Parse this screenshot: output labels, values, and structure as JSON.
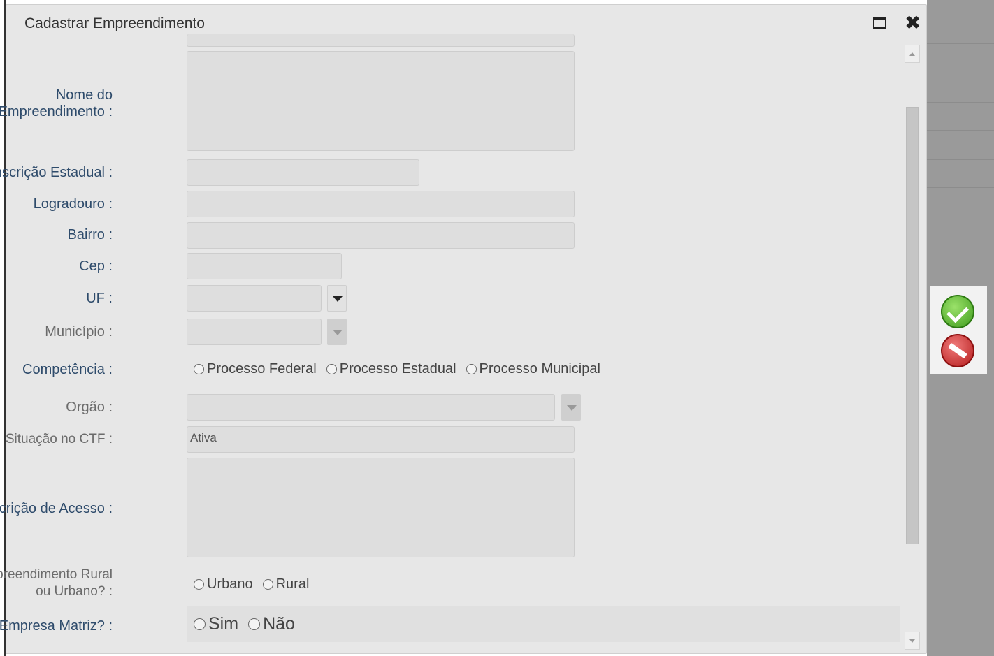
{
  "dialog": {
    "title": "Cadastrar Empreendimento"
  },
  "form": {
    "nome_label_1": "Nome do",
    "nome_label_2": "Empreendimento :",
    "inscricao_label": "Inscrição Estadual :",
    "logradouro_label": "Logradouro :",
    "bairro_label": "Bairro :",
    "cep_label": "Cep :",
    "uf_label": "UF :",
    "municipio_label": "Município :",
    "competencia_label": "Competência :",
    "competencia_options": [
      "Processo Federal",
      "Processo Estadual",
      "Processo Municipal"
    ],
    "orgao_label": "Orgão :",
    "situacao_label": "Situação no CTF :",
    "situacao_value": "Ativa",
    "descricao_label": "Descrição de Acesso :",
    "rural_label_1": "Empreendimento Rural",
    "rural_label_2": "ou Urbano? :",
    "rural_options": [
      "Urbano",
      "Rural"
    ],
    "matriz_label": "Empresa Matriz? :",
    "matriz_options": [
      "Sim",
      "Não"
    ]
  },
  "icons": {
    "maximize": "maximize-icon",
    "close": "close-icon",
    "confirm": "check-circle-icon",
    "cancel": "no-entry-icon"
  },
  "colors": {
    "label": "#2e4b6b",
    "confirm": "#3f9b1e",
    "cancel": "#b41c1c"
  }
}
